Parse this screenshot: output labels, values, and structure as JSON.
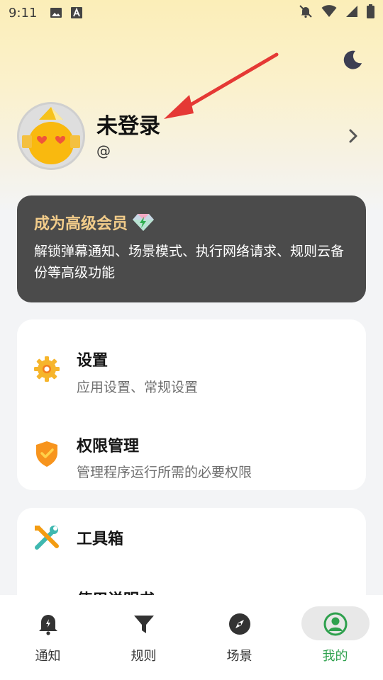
{
  "status_bar": {
    "time": "9:11",
    "left_icons": [
      "image-icon",
      "font-a-icon"
    ],
    "right_icons": [
      "bell-off-icon",
      "wifi-icon",
      "signal-icon",
      "battery-icon"
    ]
  },
  "header": {
    "theme_toggle_icon": "moon-icon"
  },
  "profile": {
    "name": "未登录",
    "handle": "@",
    "avatar_icon": "cartoon-avatar-icon",
    "chevron_icon": "chevron-right-icon"
  },
  "vip_banner": {
    "title": "成为高级会员",
    "badge_icon": "diamond-icon",
    "description": "解锁弹幕通知、场景模式、执行网络请求、规则云备份等高级功能",
    "bg_color": "#4b4b4b",
    "title_color": "#f2cc8a"
  },
  "settings_card": {
    "items": [
      {
        "title": "设置",
        "subtitle": "应用设置、常规设置",
        "icon": "gear-icon"
      },
      {
        "title": "权限管理",
        "subtitle": "管理程序运行所需的必要权限",
        "icon": "shield-check-icon"
      }
    ]
  },
  "tools_card": {
    "items": [
      {
        "title": "工具箱",
        "icon": "wrench-screwdriver-icon"
      },
      {
        "title": "使用说明书",
        "icon": ""
      }
    ]
  },
  "bottom_nav": {
    "items": [
      {
        "label": "通知",
        "icon": "bell-icon",
        "active": false
      },
      {
        "label": "规则",
        "icon": "filter-icon",
        "active": false
      },
      {
        "label": "场景",
        "icon": "compass-icon",
        "active": false
      },
      {
        "label": "我的",
        "icon": "user-circle-icon",
        "active": true
      }
    ],
    "active_color": "#2fa14e"
  }
}
